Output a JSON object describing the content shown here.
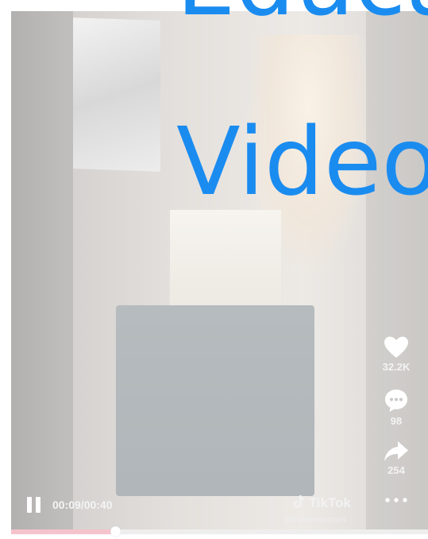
{
  "overlay": {
    "title_line1": "Educa",
    "title_line2": "Video"
  },
  "actions": {
    "like_count": "32.2K",
    "comment_count": "98",
    "share_count": "254",
    "more_icon": "ellipsis-icon"
  },
  "player": {
    "time": "00:09/00:40",
    "progress": 0.25,
    "watermark": "TikTok",
    "handle": "@travelmomoirs"
  },
  "colors": {
    "title": "#1a8cf0",
    "progress_fill": "#f6c3cc"
  }
}
